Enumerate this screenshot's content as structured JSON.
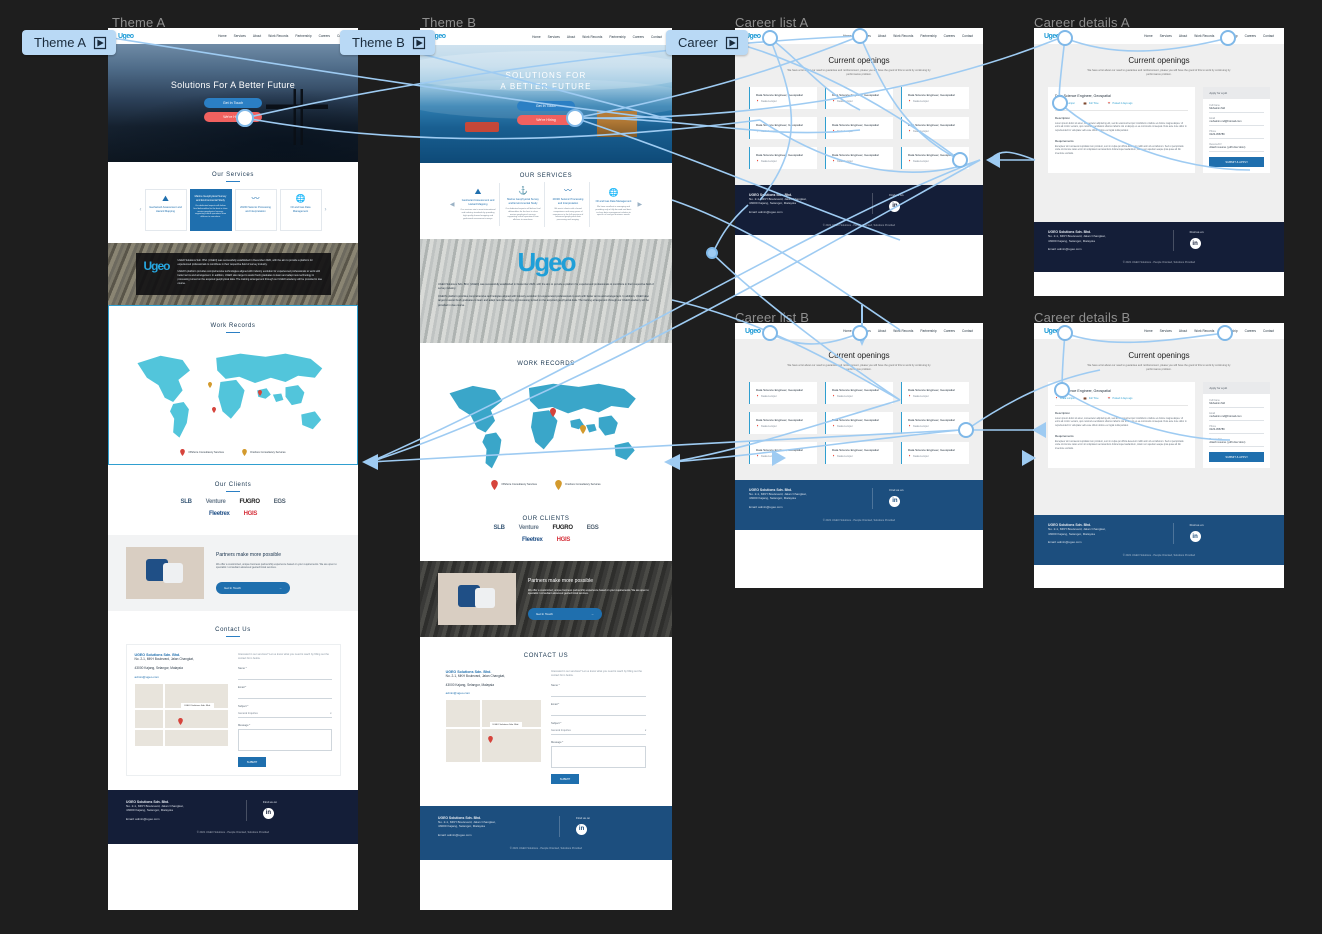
{
  "canvas": {
    "background": "#1e1e1e",
    "accent": "#9ecbf2"
  },
  "frames": [
    {
      "id": "theme-a",
      "title": "Theme A"
    },
    {
      "id": "theme-b",
      "title": "Theme B"
    },
    {
      "id": "career-list-a",
      "title": "Career list A"
    },
    {
      "id": "career-details-a",
      "title": "Career details A"
    },
    {
      "id": "career-list-b",
      "title": "Career list B"
    },
    {
      "id": "career-details-b",
      "title": "Career details B"
    }
  ],
  "badges": [
    {
      "label": "Theme A",
      "icon": "flow-start-icon"
    },
    {
      "label": "Theme B",
      "icon": "flow-start-icon"
    },
    {
      "label": "Career",
      "icon": "flow-start-icon"
    }
  ],
  "site": {
    "logo": "Ugeo",
    "nav": [
      "Home",
      "Services",
      "About",
      "Work Records",
      "Partnership",
      "Careers",
      "Contact"
    ],
    "hero_a": {
      "title": "Solutions For A Better Future",
      "primary_button": "Get In Touch",
      "accent_button": "We're Hiring"
    },
    "hero_b": {
      "title_line1": "SOLUTIONS FOR",
      "title_line2": "A BETTER FUTURE",
      "primary_button": "Get In Touch",
      "accent_button": "We're Hiring"
    },
    "services": {
      "heading_a": "Our Services",
      "heading_b": "OUR SERVICES",
      "items": [
        {
          "icon": "mountain-icon",
          "name": "Geohazard Assessment and Hazard Mapping",
          "desc": "Our services aim to meet international and industry standards by providing high quality hazard mapping and geohazard assessment surveys.",
          "active": false
        },
        {
          "icon": "ship-icon",
          "name": "Marine Geophysical Survey and Environmental Study",
          "desc": "Our dedicated experts will deliver final deliverables for the best in class marine geophysical surveys, supporting critical operations from offshore to nearshore.",
          "active": true
        },
        {
          "icon": "seismic-icon",
          "name": "2D/3D Seismic Processing and Interpretation",
          "desc": "We assist clients with a broad competence and many years of experience in the full spectrum of advanced geophysical data processing and imaging.",
          "active": false
        },
        {
          "icon": "globe-icon",
          "name": "Oil and Gas Data Management",
          "desc": "We have excellent in managing and providing only a fully focused and best-in-class data management solution to specific oil and gas business needs.",
          "active": false
        }
      ]
    },
    "about": {
      "logo": "Ugeo",
      "paragraphs": [
        "UGEO Solutions Sdn. Bhd. (UGEO) was successfully established in December 2020, with the aim to provide a platform for experienced professionals to contribute in their respective field of survey industry.",
        "UGEO's platform provides comprehensive technologies aligned with industry evolution for experienced professionals to work with better terms and arrangement. In addition, UGEO also target to assist fresh graduates to learn and adapt new technology in processing turned on the acquired geophysical data. The training arrangement through our UGEO academy will be provided in due course."
      ]
    },
    "work_records": {
      "heading_a": "Work Records",
      "heading_b": "WORK RECORDS",
      "legend": [
        {
          "color": "#d6443c",
          "label": "Offshore Consultancy Services"
        },
        {
          "color": "#d39a2d",
          "label": "Onshore Consultancy Services"
        }
      ]
    },
    "clients": {
      "heading_a": "Our Clients",
      "heading_b": "OUR CLIENTS",
      "logos": [
        "SLB",
        "Venture",
        "FUGRO",
        "EGS",
        "Fleetrex",
        "HGIS"
      ]
    },
    "partners": {
      "title": "Partners make more possible",
      "desc": "We offer a customized, unique business partnership experience based on your requirements. We are open to specialist / consultant advanced geotechnical services.",
      "button": "Get In Touch"
    },
    "contact": {
      "heading_a": "Contact Us",
      "heading_b": "CONTACT US",
      "company": "UGEO Solutions Sdn. Bhd.",
      "address_line1": "No. 2-1, MKH Boulevard, Jalan Changkat,",
      "address_line2": "43000 Kajang, Selangor, Malaysia",
      "email": "admin@ugeo.com",
      "map_pin_label": "UGEO Solutions Sdn. Bhd.",
      "form": {
        "intro": "Interested in our services? Let us know what you need & reach by filling out the contact form below.",
        "name_label": "Name *",
        "email_label": "Email *",
        "subject_label": "Subject *",
        "subject_value": "General Inquiries",
        "message_label": "Message *",
        "submit": "SUBMIT"
      }
    },
    "footer": {
      "company": "UGEO Solutions Sdn. Bhd.",
      "address_line1": "No. 2-1, MKH Boulevard, Jalan Changkat,",
      "address_line2": "43000 Kajang, Selangor, Malaysia",
      "email": "Email: admin@ugeo.com",
      "find_us": "Find us on",
      "social": "linkedin-icon",
      "copyright": "© 2021 UGEO Solutions - People Oriented, Solutions Provided"
    }
  },
  "career": {
    "title": "Current openings",
    "subtitle": "We have a list about our need to guarantee and reinforcement, please you will have the good of this to work by continuing by performance problem.",
    "job_title": "Data Science Engineer, Geospatial",
    "locations": [
      "Kuala Lumpur",
      "Kuala Lumpur",
      "Kuala Lumpur",
      "Kuala Lumpur",
      "Kuala Lumpur",
      "Kuala Lumpur",
      "Kuala Lumpur",
      "Kuala Lumpur",
      "Kuala Lumpur"
    ],
    "card_count": 9,
    "details": {
      "job_title": "Data Science Engineer, Geospatial",
      "meta": [
        {
          "icon": "location-icon",
          "text": "Kuala Lumpur"
        },
        {
          "icon": "briefcase-icon",
          "text": "Full Time"
        },
        {
          "icon": "calendar-icon",
          "text": "Posted 2 days ago"
        }
      ],
      "description_heading": "Description",
      "description": "Lorem ipsum dolor sit amet, consectetur adipiscing elit, sed do eiusmod tempor incididunt ut labore et dolore magna aliqua. Ut enim ad minim veniam, quis nostrud exercitation ullamco laboris nisi ut aliquip ex ea commodo consequat. Duis aute irure dolor in reprehenderit in voluptate velit esse cillum dolore eu fugiat nulla pariatur.",
      "requirements_heading": "Requirements",
      "requirements": "Excepteur sint occaecat cupidatat non proident, sunt in culpa qui officia deserunt mollit anim id est laborum. Sed ut perspiciatis unde omnis iste natus error sit voluptatem accusantium doloremque laudantium, totam rem aperiam eaque ipsa quae ab illo inventore veritatis.",
      "form_heading": "Apply for a job",
      "fields": [
        {
          "label": "Full Name",
          "value": "Muhaimin Md"
        },
        {
          "label": "Email",
          "value": "muhaimin.md@hotmail.com"
        },
        {
          "label": "Phone",
          "value": "0123-456789"
        },
        {
          "label": "Resume/CV",
          "value": "Attach resume (.pdf/.doc/.docx)"
        }
      ],
      "submit": "SUBMIT & APPLY"
    }
  }
}
